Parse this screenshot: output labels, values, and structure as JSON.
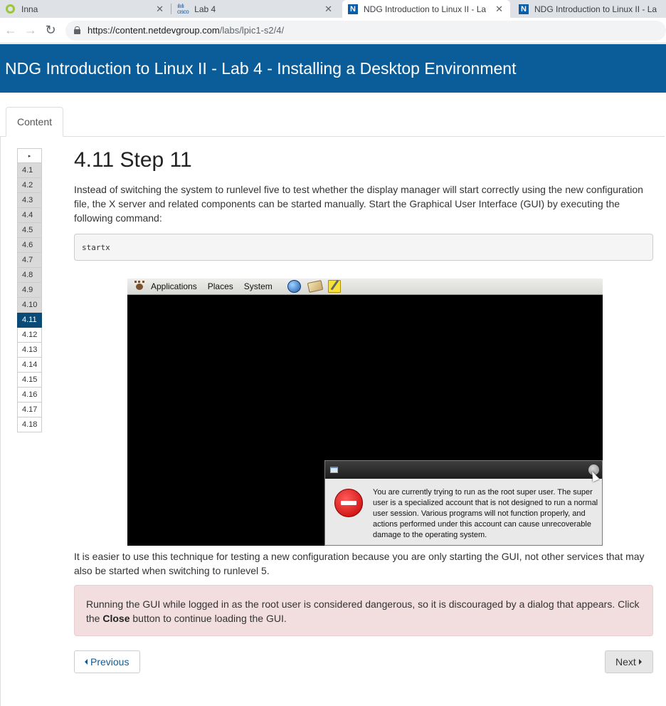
{
  "browser": {
    "tabs": [
      {
        "title": "Inna",
        "icon": "circle-icon"
      },
      {
        "title": "Lab 4",
        "icon": "cisco-icon"
      },
      {
        "title": "NDG Introduction to Linux II - La",
        "icon": "ndg-icon"
      },
      {
        "title": "NDG Introduction to Linux II - La",
        "icon": "ndg-icon"
      }
    ],
    "close_glyph": "✕",
    "url_host": "https://content.netdevgroup.com",
    "url_path": "/labs/lpic1-s2/4/"
  },
  "header": {
    "title": "NDG Introduction to Linux II - Lab 4 - Installing a Desktop Environment"
  },
  "content_tab": {
    "label": "Content"
  },
  "sidebar": {
    "toggle_glyph": "▸",
    "steps": [
      "4.1",
      "4.2",
      "4.3",
      "4.4",
      "4.5",
      "4.6",
      "4.7",
      "4.8",
      "4.9",
      "4.10",
      "4.11",
      "4.12",
      "4.13",
      "4.14",
      "4.15",
      "4.16",
      "4.17",
      "4.18"
    ],
    "current": "4.11"
  },
  "main": {
    "title": "4.11 Step 11",
    "intro": "Instead of switching the system to runlevel five to test whether the display manager will start correctly using the new configuration file, the X server and related components can be started manually. Start the Graphical User Interface (GUI) by executing the following command:",
    "command": "startx",
    "after": "It is easier to use this technique for testing a new configuration because you are only starting the GUI, not other services that may also be started when switching to runlevel 5.",
    "alert_pre": "Running the GUI while logged in as the root user is considered dangerous, so it is discouraged by a dialog that appears. Click the ",
    "alert_bold": "Close",
    "alert_post": " button to continue loading the GUI."
  },
  "screenshot": {
    "menus": [
      "Applications",
      "Places",
      "System"
    ],
    "dialog_text": "You are currently trying to run as the root super user.  The super user is a specialized account that is not designed to run a normal user session.  Various programs will not function properly, and actions performed under this account can cause unrecoverable damage to the operating system."
  },
  "nav": {
    "previous": "Previous",
    "next": "Next"
  }
}
